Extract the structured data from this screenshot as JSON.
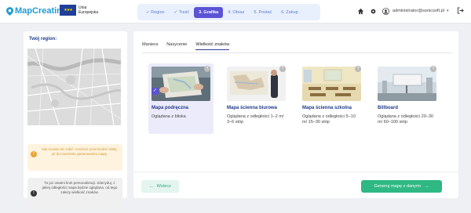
{
  "header": {
    "logo_text": "MapCreating",
    "eu_label_line1": "Unia",
    "eu_label_line2": "Europejska",
    "steps": [
      {
        "label": "Region",
        "state": "done"
      },
      {
        "label": "Treść",
        "state": "done"
      },
      {
        "label": "3. Grafika",
        "state": "active"
      },
      {
        "label": "4. Obraz",
        "state": "todo"
      },
      {
        "label": "5. Postać",
        "state": "todo"
      },
      {
        "label": "6. Zakup",
        "state": "todo"
      }
    ],
    "user_email": "administrator@sonicsoft.pl"
  },
  "left": {
    "region_title": "Twój region:",
    "warning_text": "Nie musisz nic robić i możesz przechodzić dalej, aż do momentu generowania mapy.",
    "info_text": "To już ostatni krok personalizacji. Zdecyduj, z jakiej odległości mapa będzie oglądana, od tego zależy wielkość znaków."
  },
  "main": {
    "tabs": [
      "Maniera",
      "Nasycenie",
      "Wielkość znaków"
    ],
    "active_tab": "Wielkość znaków",
    "cards": [
      {
        "title": "Mapa podręczna",
        "desc": "Oglądana z bliska",
        "selected": true
      },
      {
        "title": "Mapa ścienna biurowa",
        "desc": "Oglądana z odległości 1–2 m/ 3–6 stóp",
        "selected": false
      },
      {
        "title": "Mapa ścienna szkolna",
        "desc": "Oglądana z odległości 5–10 m/ 15–30 stóp",
        "selected": false
      },
      {
        "title": "Billboard",
        "desc": "Oglądana z odległości 20–30 m/ 60–100 stóp",
        "selected": false
      }
    ],
    "back_label": "Wstecz",
    "generate_label": "Generuj mapę z danymi"
  },
  "colors": {
    "accent": "#5b53d4",
    "primary_green": "#2fb884",
    "title_blue": "#1f3a8a"
  }
}
